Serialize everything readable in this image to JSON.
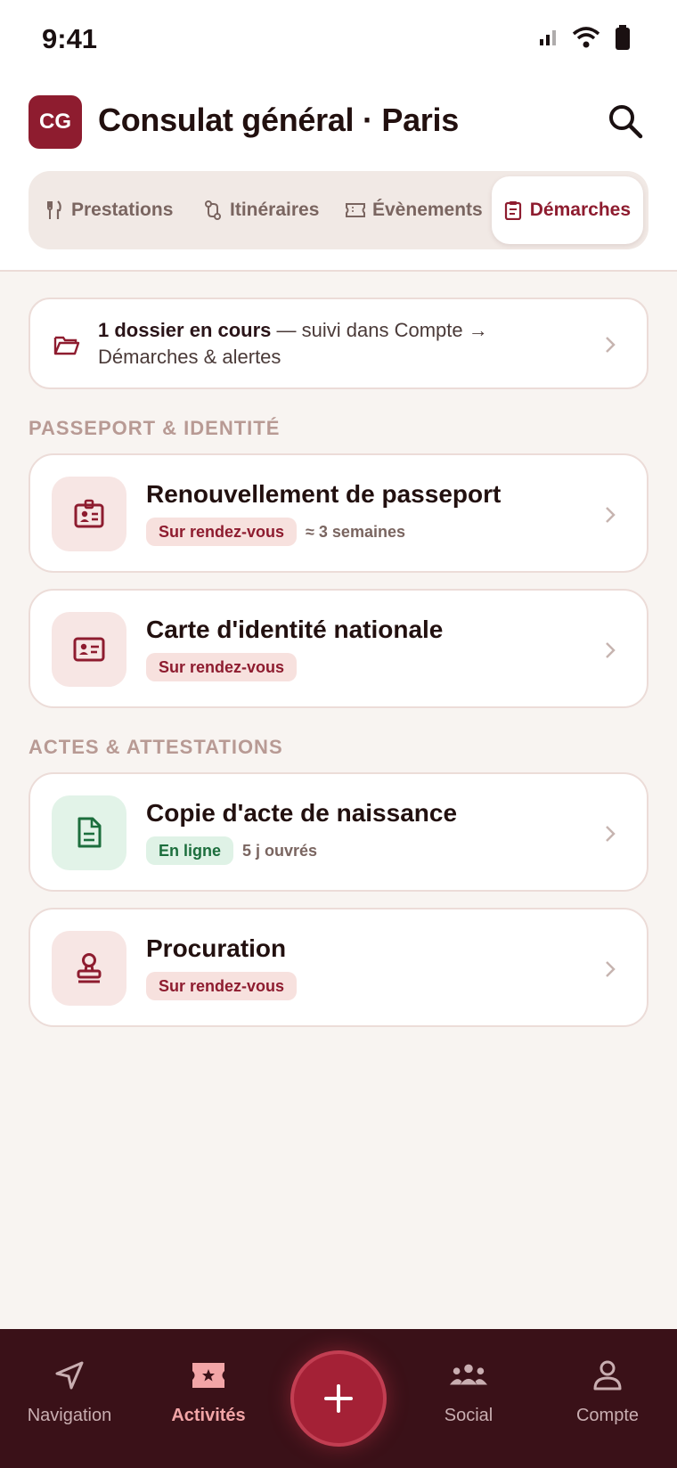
{
  "status_bar": {
    "time": "9:41"
  },
  "header": {
    "logo_text": "CG",
    "title": "Consulat général · Paris",
    "tabs": [
      {
        "label": "Prestations",
        "icon": "fork-knife-icon",
        "active": false
      },
      {
        "label": "Itinéraires",
        "icon": "route-icon",
        "active": false
      },
      {
        "label": "Évènements",
        "icon": "ticket-icon",
        "active": false
      },
      {
        "label": "Démarches",
        "icon": "clipboard-icon",
        "active": true
      }
    ]
  },
  "banner": {
    "bold": "1 dossier en cours",
    "text": " — suivi dans Compte → Démarches & alertes"
  },
  "sections": [
    {
      "label": "PASSEPORT & IDENTITÉ",
      "items": [
        {
          "title": "Renouvellement de passeport",
          "badge": "Sur rendez-vous",
          "meta": "≈ 3 semaines",
          "icon": "id-badge-icon"
        },
        {
          "title": "Carte d'identité nationale",
          "badge": "Sur rendez-vous",
          "meta": "",
          "icon": "id-card-icon"
        }
      ]
    },
    {
      "label": "ACTES & ATTESTATIONS",
      "items": [
        {
          "title": "Copie d'acte de naissance",
          "badge": "En ligne",
          "meta": "5 j ouvrés",
          "icon": "document-icon"
        },
        {
          "title": "Procuration",
          "badge": "Sur rendez-vous",
          "meta": "",
          "icon": "stamp-icon"
        }
      ]
    }
  ],
  "bottom_nav": {
    "items": [
      {
        "label": "Navigation",
        "icon": "send-arrow-icon",
        "active": false
      },
      {
        "label": "Activités",
        "icon": "ticket-star-icon",
        "active": true
      },
      {
        "label": "Social",
        "icon": "group-icon",
        "active": false
      },
      {
        "label": "Compte",
        "icon": "person-icon",
        "active": false
      }
    ]
  },
  "colors": {
    "accent": "#8e1c2f",
    "nav_background": "#3a1118",
    "background": "#f8f4f1",
    "badge_green": "#1c6e3d"
  }
}
